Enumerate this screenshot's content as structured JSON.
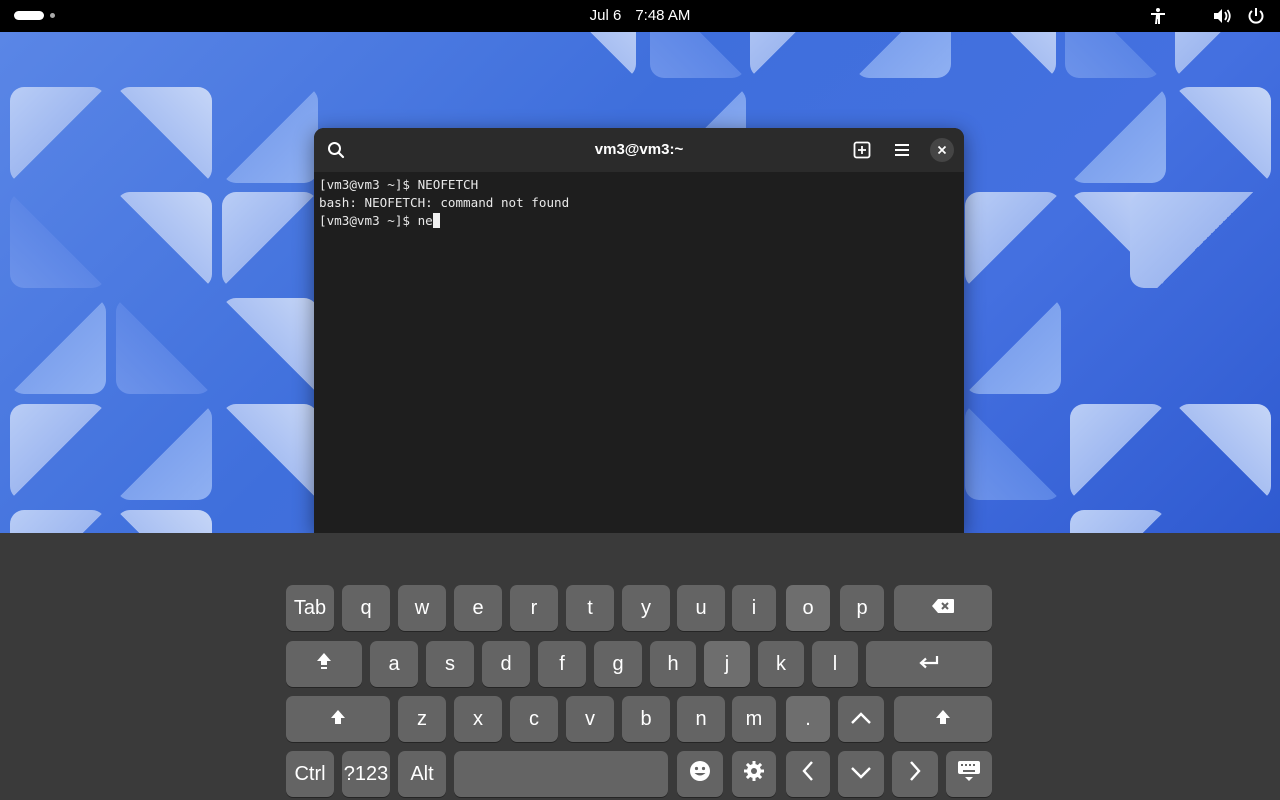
{
  "topbar": {
    "date": "Jul 6",
    "time": "7:48 AM",
    "icons": [
      "activities-indicator",
      "accessibility-icon",
      "volume-icon",
      "power-icon"
    ]
  },
  "terminal": {
    "title": "vm3@vm3:~",
    "header_icons": [
      "search-icon",
      "new-tab-icon",
      "menu-icon",
      "close-icon"
    ],
    "lines": [
      "[vm3@vm3 ~]$ NEOFETCH",
      "bash: NEOFETCH: command not found",
      "[vm3@vm3 ~]$ ne"
    ]
  },
  "keyboard": {
    "row1": [
      "Tab",
      "q",
      "w",
      "e",
      "r",
      "t",
      "y",
      "u",
      "i",
      "o",
      "p"
    ],
    "row2": [
      "a",
      "s",
      "d",
      "f",
      "g",
      "h",
      "j",
      "k",
      "l"
    ],
    "row3": [
      "z",
      "x",
      "c",
      "v",
      "b",
      "n",
      "m",
      "."
    ],
    "row4": [
      "Ctrl",
      "?123",
      "Alt"
    ],
    "icon_keys": [
      "backspace-icon",
      "shift-icon",
      "enter-icon",
      "up-arrow-icon",
      "emoji-icon",
      "settings-icon",
      "left-arrow-icon",
      "down-arrow-icon",
      "right-arrow-icon",
      "hide-keyboard-icon"
    ]
  },
  "colors": {
    "topbar": "#000000",
    "wallpaper": "#4470e0",
    "terminal_bg": "#1e1e1e",
    "key": "#646464",
    "osk_bg": "#3a3a3a"
  }
}
